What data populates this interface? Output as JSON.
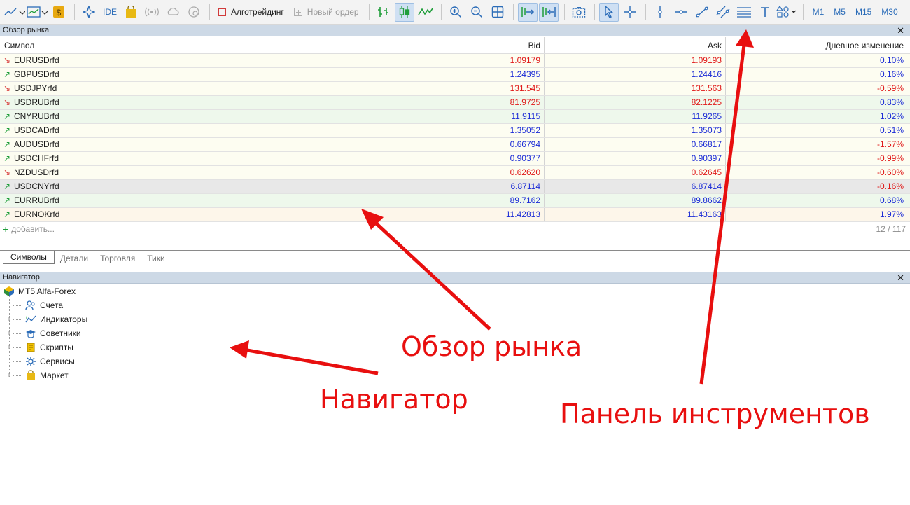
{
  "toolbar": {
    "algotrading_label": "Алготрейдинг",
    "new_order_label": "Новый ордер",
    "ide_label": "IDE",
    "timeframes": [
      "M1",
      "M5",
      "M15",
      "M30"
    ]
  },
  "market_watch": {
    "title": "Обзор рынка",
    "columns": {
      "symbol": "Символ",
      "bid": "Bid",
      "ask": "Ask",
      "change": "Дневное изменение"
    },
    "rows": [
      {
        "symbol": "EURUSDrfd",
        "dir": "down",
        "bid": "1.09179",
        "ask": "1.09193",
        "change": "0.10%",
        "bid_color": "red",
        "ask_color": "red",
        "chg_color": "blue",
        "bg": "#fdfdf1"
      },
      {
        "symbol": "GBPUSDrfd",
        "dir": "up",
        "bid": "1.24395",
        "ask": "1.24416",
        "change": "0.16%",
        "bid_color": "blue",
        "ask_color": "blue",
        "chg_color": "blue",
        "bg": "#fdfdf1"
      },
      {
        "symbol": "USDJPYrfd",
        "dir": "down",
        "bid": "131.545",
        "ask": "131.563",
        "change": "-0.59%",
        "bid_color": "red",
        "ask_color": "red",
        "chg_color": "red",
        "bg": "#fdfdf1"
      },
      {
        "symbol": "USDRUBrfd",
        "dir": "down",
        "bid": "81.9725",
        "ask": "82.1225",
        "change": "0.83%",
        "bid_color": "red",
        "ask_color": "red",
        "chg_color": "blue",
        "bg": "#eef8ec"
      },
      {
        "symbol": "CNYRUBrfd",
        "dir": "up",
        "bid": "11.9115",
        "ask": "11.9265",
        "change": "1.02%",
        "bid_color": "blue",
        "ask_color": "blue",
        "chg_color": "blue",
        "bg": "#eef8ec"
      },
      {
        "symbol": "USDCADrfd",
        "dir": "up",
        "bid": "1.35052",
        "ask": "1.35073",
        "change": "0.51%",
        "bid_color": "blue",
        "ask_color": "blue",
        "chg_color": "blue",
        "bg": "#fdfdf1"
      },
      {
        "symbol": "AUDUSDrfd",
        "dir": "up",
        "bid": "0.66794",
        "ask": "0.66817",
        "change": "-1.57%",
        "bid_color": "blue",
        "ask_color": "blue",
        "chg_color": "red",
        "bg": "#fdfdf1"
      },
      {
        "symbol": "USDCHFrfd",
        "dir": "up",
        "bid": "0.90377",
        "ask": "0.90397",
        "change": "-0.99%",
        "bid_color": "blue",
        "ask_color": "blue",
        "chg_color": "red",
        "bg": "#fdfdf1"
      },
      {
        "symbol": "NZDUSDrfd",
        "dir": "down",
        "bid": "0.62620",
        "ask": "0.62645",
        "change": "-0.60%",
        "bid_color": "red",
        "ask_color": "red",
        "chg_color": "red",
        "bg": "#fdfdf1"
      },
      {
        "symbol": "USDCNYrfd",
        "dir": "up",
        "bid": "6.87114",
        "ask": "6.87414",
        "change": "-0.16%",
        "bid_color": "blue",
        "ask_color": "blue",
        "chg_color": "red",
        "bg": "#e8e8e8"
      },
      {
        "symbol": "EURRUBrfd",
        "dir": "up",
        "bid": "89.7162",
        "ask": "89.8662",
        "change": "0.68%",
        "bid_color": "blue",
        "ask_color": "blue",
        "chg_color": "blue",
        "bg": "#eef8ec"
      },
      {
        "symbol": "EURNOKrfd",
        "dir": "up",
        "bid": "11.42813",
        "ask": "11.43163",
        "change": "1.97%",
        "bid_color": "blue",
        "ask_color": "blue",
        "chg_color": "blue",
        "bg": "#fdf6ea"
      }
    ],
    "add_label": "добавить...",
    "count": "12 / 117",
    "tabs": [
      "Символы",
      "Детали",
      "Торговля",
      "Тики"
    ]
  },
  "navigator": {
    "title": "Навигатор",
    "root_label": "MT5 Alfa-Forex",
    "items": [
      {
        "label": "Счета",
        "icon": "accounts-icon",
        "expandable": false
      },
      {
        "label": "Индикаторы",
        "icon": "indicators-icon",
        "expandable": true
      },
      {
        "label": "Советники",
        "icon": "experts-icon",
        "expandable": true
      },
      {
        "label": "Скрипты",
        "icon": "scripts-icon",
        "expandable": true
      },
      {
        "label": "Сервисы",
        "icon": "services-icon",
        "expandable": false
      },
      {
        "label": "Маркет",
        "icon": "market-icon",
        "expandable": true
      }
    ]
  },
  "annotations": {
    "market": "Обзор рынка",
    "navigator": "Навигатор",
    "toolbar": "Панель инструментов",
    "color": "#e80f0f"
  },
  "colors": {
    "up": "#1f9e3a",
    "down": "#d42a2a",
    "blue": "#1b2bd6",
    "red": "#e01919",
    "header": "#cdd9e6"
  }
}
